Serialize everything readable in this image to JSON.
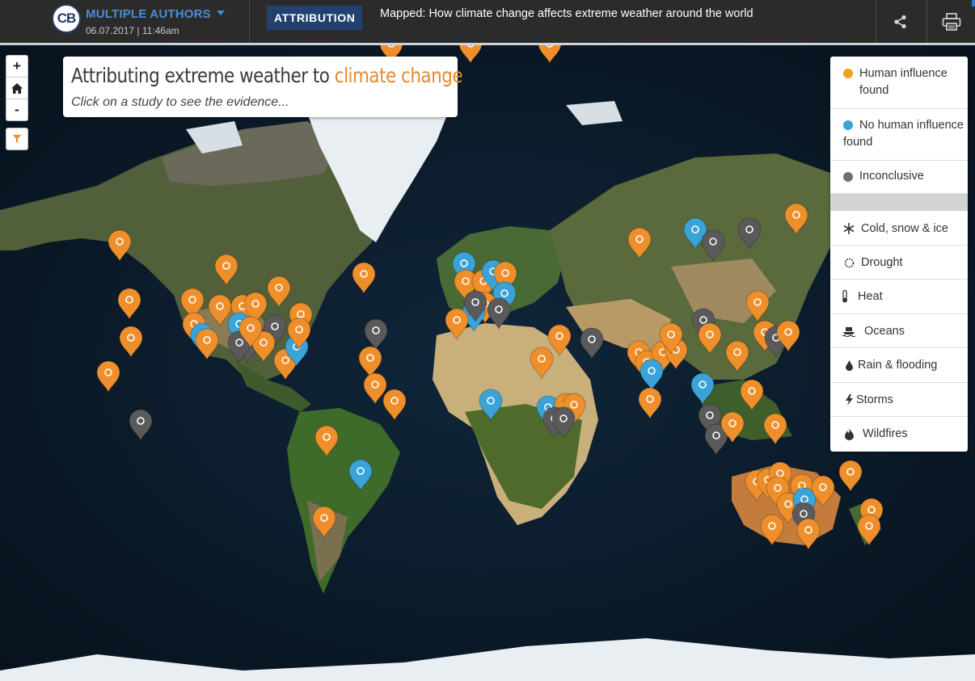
{
  "header": {
    "logo_text": "CB",
    "author": "MULTIPLE AUTHORS",
    "date": "06.07.2017 | 11:46am",
    "category": "ATTRIBUTION",
    "headline": "Mapped: How climate change affects extreme weather around the world",
    "share_icon": "share-icon",
    "print_icon": "print-icon"
  },
  "map": {
    "title_prefix": "Attributing extreme weather to ",
    "title_highlight": "climate change",
    "subtitle": "Click on a study to see the evidence...",
    "zoom_in": "+",
    "home_icon": "home-icon",
    "zoom_out": "-",
    "filter_icon": "filter-icon"
  },
  "legend": {
    "outcomes": [
      {
        "label": "Human influence found",
        "color": "#f0a21e"
      },
      {
        "label": "No human influence found",
        "color": "#3aa3d8"
      },
      {
        "label": "Inconclusive",
        "color": "#707070"
      }
    ],
    "types": [
      {
        "label": "Cold, snow & ice",
        "icon": "snowflake-icon"
      },
      {
        "label": "Drought",
        "icon": "sun-icon"
      },
      {
        "label": "Heat",
        "icon": "thermometer-icon"
      },
      {
        "label": "Oceans",
        "icon": "ocean-icon"
      },
      {
        "label": "Rain & flooding",
        "icon": "raindrop-icon"
      },
      {
        "label": "Storms",
        "icon": "lightning-icon"
      },
      {
        "label": "Wildfires",
        "icon": "flame-icon"
      }
    ]
  },
  "colors": {
    "human": "#ee8f2c",
    "none": "#3aa3d8",
    "inconclusive": "#5a5a5a",
    "accent": "#e68a2e",
    "category_bg": "#23416f"
  }
}
